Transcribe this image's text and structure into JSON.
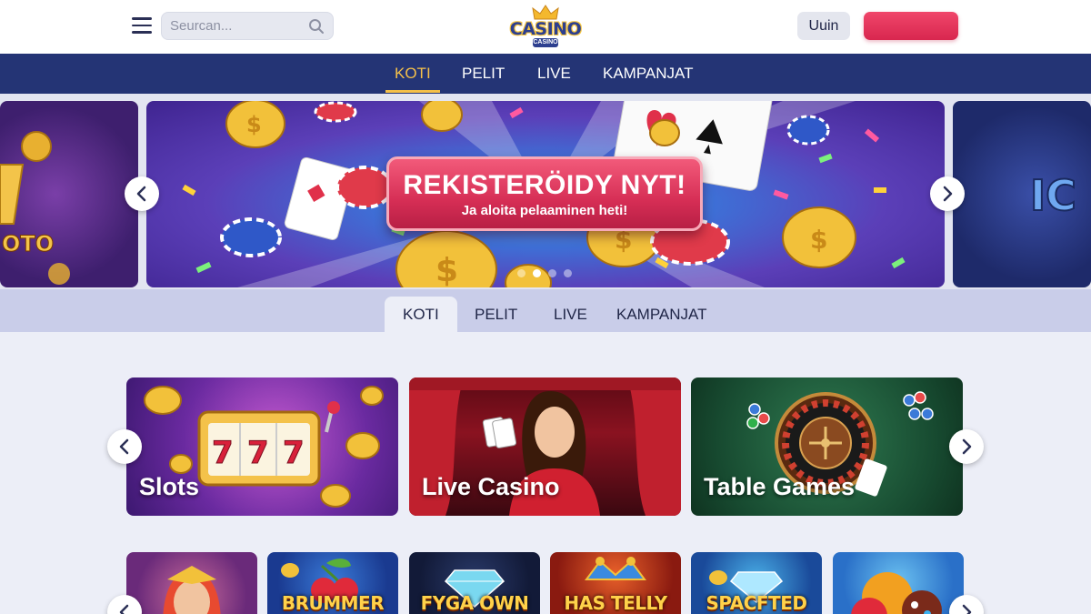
{
  "header": {
    "search_placeholder": "Seurcan...",
    "logo_text": "CASINO",
    "logo_subtext": "CASINO",
    "login_label": "Uuin",
    "register_label": "",
    "brand_color": "#243475",
    "accent_color": "#f5c04a",
    "cta_color": "#e0355c"
  },
  "main_nav": {
    "tabs": [
      {
        "label": "KOTI",
        "active": true
      },
      {
        "label": "PELIT",
        "active": false
      },
      {
        "label": "LIVE",
        "active": false
      },
      {
        "label": "KAMPANJAT",
        "active": false
      }
    ]
  },
  "hero": {
    "title": "REKISTERÖIDY NYT!",
    "subtitle": "Ja aloita pelaaminen heti!",
    "slide_count": 4,
    "active_slide": 2,
    "left_peek_text": "OTO",
    "right_peek_text": "IC"
  },
  "sub_nav": {
    "tabs": [
      {
        "label": "KOTI",
        "active": true
      },
      {
        "label": "PELIT",
        "active": false
      },
      {
        "label": "LIVE",
        "active": false
      },
      {
        "label": "KAMPANJAT",
        "active": false
      }
    ]
  },
  "categories": [
    {
      "label": "Slots",
      "icon": "slot-machine-icon"
    },
    {
      "label": "Live Casino",
      "icon": "dealer-icon"
    },
    {
      "label": "Table Games",
      "icon": "roulette-icon"
    }
  ],
  "games": [
    {
      "label": ""
    },
    {
      "label": "BRUMMER"
    },
    {
      "label": "FYGA OWN"
    },
    {
      "label": "HAS TELLY"
    },
    {
      "label": "SPACFTED ILV"
    },
    {
      "label": ""
    }
  ]
}
